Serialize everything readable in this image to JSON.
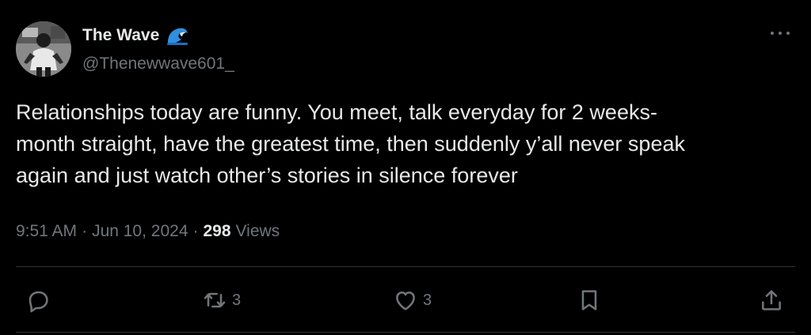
{
  "author": {
    "display_name": "The Wave",
    "name_emoji": "🌊",
    "handle": "@Thenewwave601_"
  },
  "tweet": {
    "text": "Relationships today are funny. You meet, talk everyday for 2 weeks-\nmonth straight, have the greatest time, then suddenly y’all never speak\nagain and just watch other’s stories in silence forever",
    "time": "9:51 AM",
    "date": "Jun 10, 2024",
    "views_count": "298",
    "views_label": "Views",
    "separator": "·"
  },
  "actions": {
    "reply_count": "",
    "repost_count": "3",
    "like_count": "3"
  },
  "colors": {
    "background": "#000000",
    "text": "#e7e9ea",
    "secondary_text": "#71767b",
    "divider": "#2f3336"
  }
}
